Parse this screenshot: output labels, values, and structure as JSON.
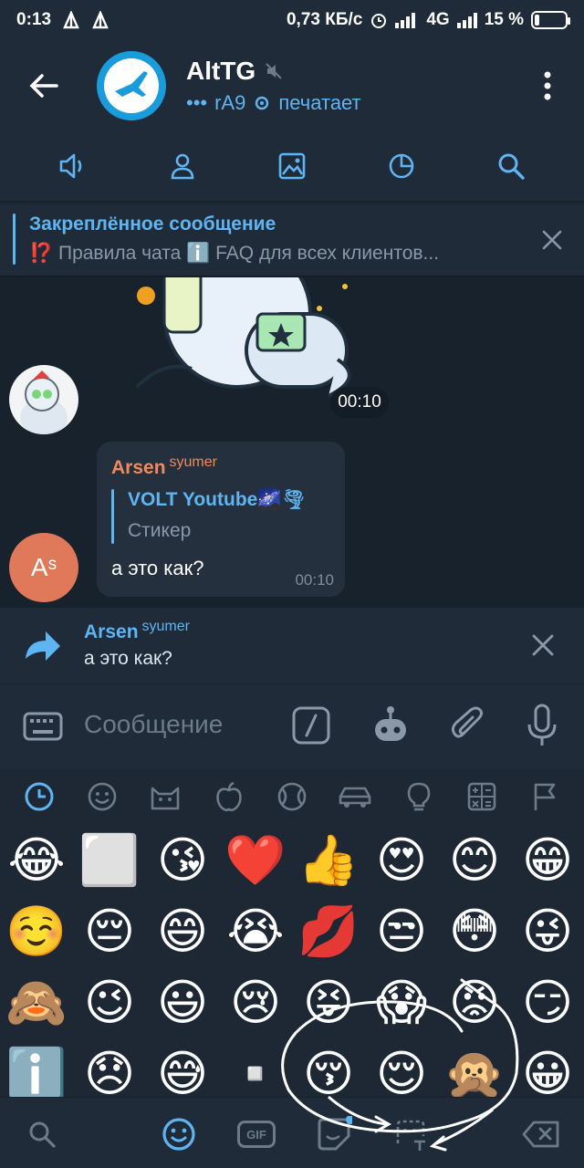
{
  "status_bar": {
    "time": "0:13",
    "speed": "0,73 КБ/с",
    "network": "4G",
    "battery": "15 %",
    "battery_level": 0.15
  },
  "header": {
    "title": "AltTG",
    "typing_user": "rA9",
    "typing_status": "печатает"
  },
  "pinned": {
    "title": "Закреплённое сообщение",
    "text": "⁉️ Правила чата  ℹ️ FAQ для всех клиентов..."
  },
  "messages": {
    "sticker_time": "00:10",
    "message": {
      "sender": "Arsen",
      "sender_tag": "syumer",
      "quote_title": "VOLT Youtube🌌🌪",
      "quote_text": "Стикер",
      "text": "а это как?",
      "time": "00:10"
    },
    "avatar_initials": "Aˢ"
  },
  "reply": {
    "name": "Arsen",
    "name_tag": "syumer",
    "text": "а это как?"
  },
  "composer": {
    "placeholder": "Сообщение"
  },
  "emoji_categories": [
    "recent-icon",
    "smile-icon",
    "cat-icon",
    "apple-icon",
    "ball-icon",
    "car-icon",
    "bulb-icon",
    "symbols-icon",
    "flag-icon"
  ],
  "emoji_rows": [
    [
      "😂",
      "⬜",
      "😘",
      "❤️",
      "👍",
      "😍",
      "😊",
      "😁"
    ],
    [
      "☺️",
      "😔",
      "😄",
      "😭",
      "💋",
      "😒",
      "😳",
      "😜"
    ],
    [
      "🙈",
      "😉",
      "😃",
      "😢",
      "😝",
      "😱",
      "😡",
      "😏"
    ],
    [
      "ℹ️",
      "😞",
      "😅",
      "▫️",
      "😚",
      "😌",
      "🙊",
      "😀"
    ]
  ],
  "bottom_bar": {
    "gif_label": "GIF"
  },
  "colors": {
    "accent": "#5fb4f2",
    "header_bg": "#1f2b38",
    "chat_bg": "#18222d",
    "sender_color": "#f08a5d"
  }
}
